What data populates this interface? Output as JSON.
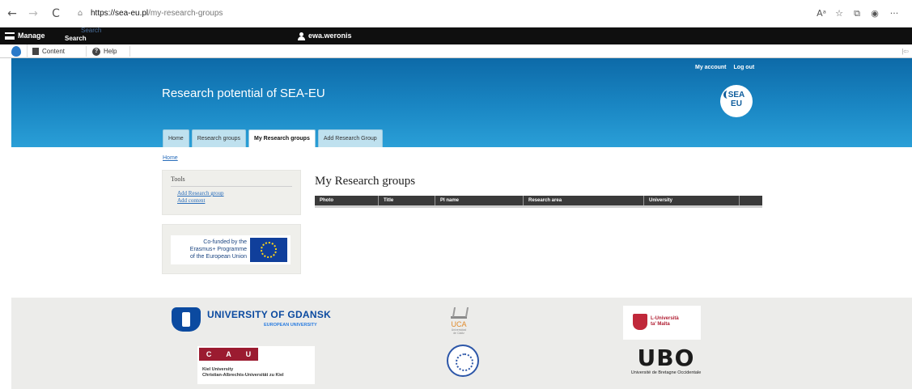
{
  "browser": {
    "url_domain": "https://sea-eu.pl",
    "url_path": "/my-research-groups",
    "back_icon": "←",
    "forward_icon": "→",
    "reload_icon": "C",
    "lock_icon": "🔒"
  },
  "admin_toolbar": {
    "manage_label": "Manage",
    "search_label": "Search",
    "search_ghost": "Search",
    "user_name": "ewa.weronis"
  },
  "secondary_toolbar": {
    "content_label": "Content",
    "help_label": "Help",
    "right_label": "|⇦"
  },
  "header": {
    "site_title": "Research potential of SEA-EU",
    "top_links": [
      "My account",
      "Log out"
    ],
    "logo_text_1": "SEA",
    "logo_text_2": "EU",
    "tabs": [
      "Home",
      "Research groups",
      "My Research groups",
      "Add Research Group"
    ],
    "active_tab": 2
  },
  "main": {
    "breadcrumb": "Home",
    "tools_title": "Tools",
    "tools_links": [
      "Add Research group",
      "Add content"
    ],
    "funded_text": [
      "Co-funded by the",
      "Erasmus+ Programme",
      "of the European Union"
    ],
    "page_heading": "My Research groups",
    "table_columns": [
      "Photo",
      "Title",
      "PI name",
      "Research area",
      "University",
      ""
    ]
  },
  "footer": {
    "ug_name": "UNIVERSITY OF GDANSK",
    "ug_sub": "EUROPEAN UNIVERSITY",
    "uca_name": "UCA",
    "uca_small": [
      "Universidad",
      "de Cádiz"
    ],
    "malta_text": [
      "L-Università",
      "ta' Malta"
    ],
    "cau_letters": [
      "C",
      "A",
      "U"
    ],
    "cau_text": [
      "Kiel University",
      "Christian-Albrechts-Universität zu Kiel"
    ],
    "ubo_mark": "UBO",
    "ubo_text": "Université de Bretagne Occidentale"
  }
}
